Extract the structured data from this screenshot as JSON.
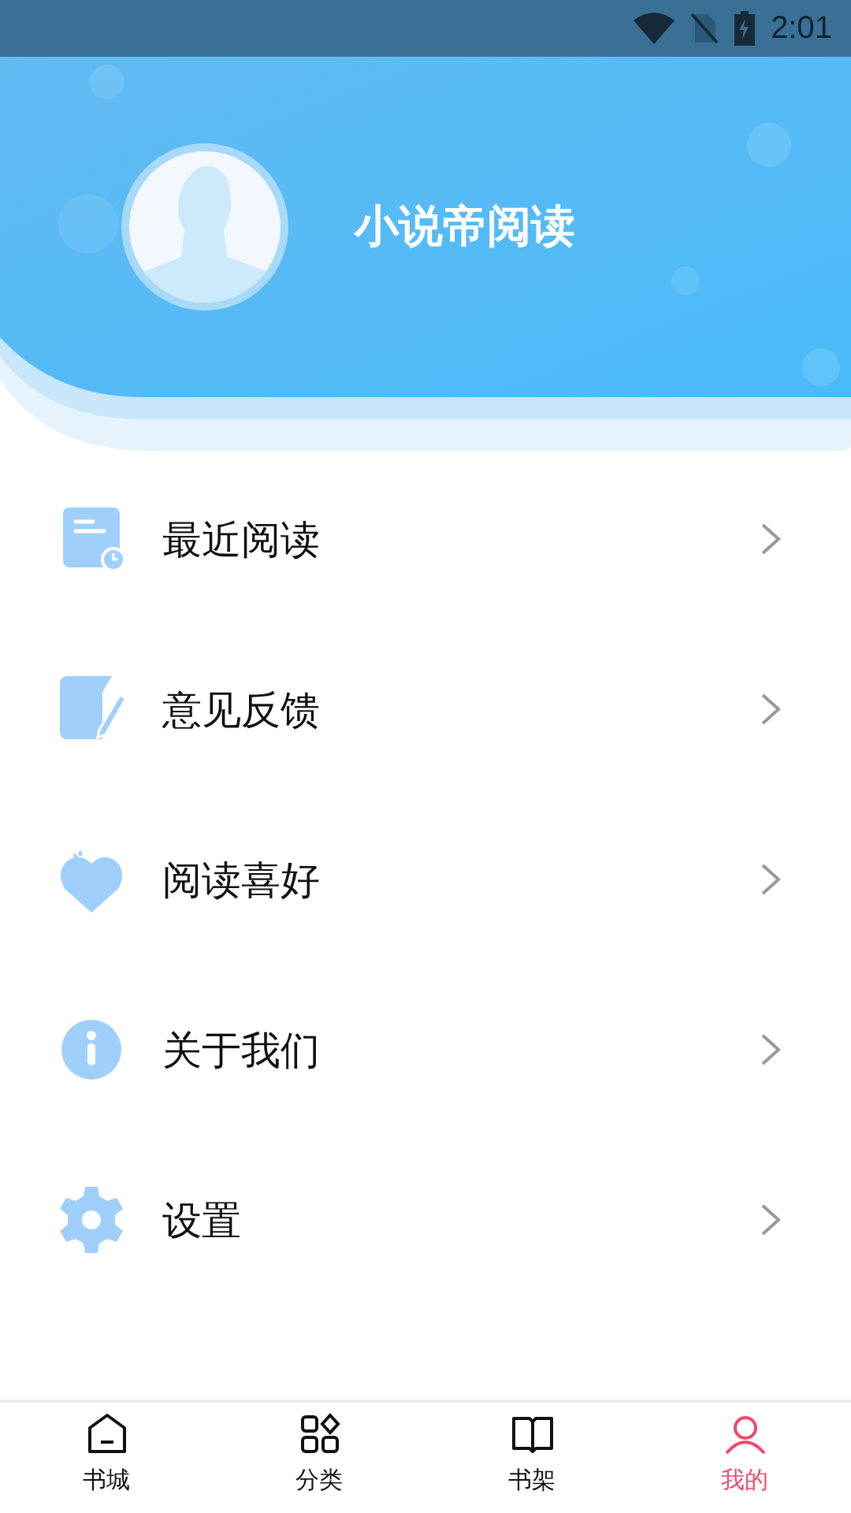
{
  "status_bar": {
    "time": "2:01"
  },
  "profile": {
    "name": "小说帝阅读"
  },
  "menu": [
    {
      "kind": "recent",
      "label": "最近阅读"
    },
    {
      "kind": "feedback",
      "label": "意见反馈"
    },
    {
      "kind": "favorite",
      "label": "阅读喜好"
    },
    {
      "kind": "about",
      "label": "关于我们"
    },
    {
      "kind": "settings",
      "label": "设置"
    }
  ],
  "tabs": [
    {
      "kind": "home",
      "label": "书城",
      "selected": false
    },
    {
      "kind": "category",
      "label": "分类",
      "selected": false
    },
    {
      "kind": "shelf",
      "label": "书架",
      "selected": false
    },
    {
      "kind": "profile",
      "label": "我的",
      "selected": true
    }
  ]
}
